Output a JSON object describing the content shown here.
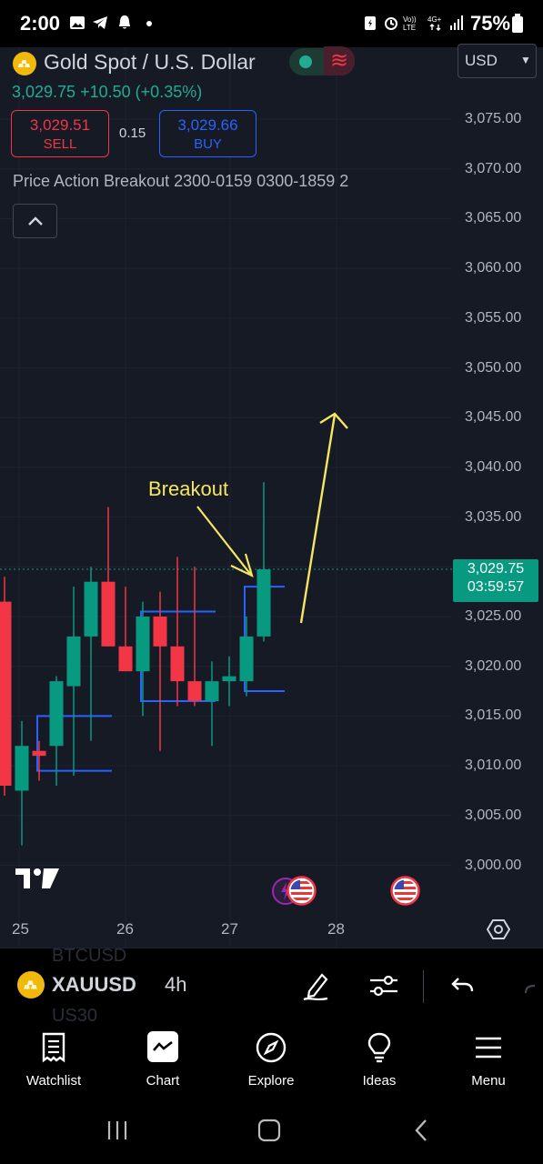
{
  "status_bar": {
    "time": "2:00",
    "battery": "75%"
  },
  "header": {
    "symbol_name": "Gold Spot / U.S. Dollar",
    "currency": "USD",
    "last_price": "3,029.75",
    "change": "+10.50",
    "change_percent": "(+0.35%)",
    "sell_price": "3,029.51",
    "sell_label": "SELL",
    "spread": "0.15",
    "buy_price": "3,029.66",
    "buy_label": "BUY",
    "indicator": "Price Action Breakout 2300-0159 0300-1859 2"
  },
  "price_scale": {
    "labels": [
      "3,075.00",
      "3,070.00",
      "3,065.00",
      "3,060.00",
      "3,055.00",
      "3,050.00",
      "3,045.00",
      "3,040.00",
      "3,035.00",
      "3,025.00",
      "3,020.00",
      "3,015.00",
      "3,010.00",
      "3,005.00",
      "3,000.00"
    ],
    "values": [
      3075,
      3070,
      3065,
      3060,
      3055,
      3050,
      3045,
      3040,
      3035,
      3025,
      3020,
      3015,
      3010,
      3005,
      3000
    ],
    "last_price_tag": "3,029.75",
    "countdown": "03:59:57"
  },
  "time_scale": {
    "labels": [
      "25",
      "26",
      "27",
      "28"
    ]
  },
  "annotation": {
    "text": "Breakout",
    "color": "#f5e663"
  },
  "chart_data": {
    "type": "candlestick",
    "symbol": "XAUUSD",
    "interval": "4h",
    "ylim": [
      2997.5,
      3079
    ],
    "up_color": "#089981",
    "down_color": "#f23645",
    "candles": [
      {
        "o": 3026.5,
        "h": 3029.0,
        "l": 3007.0,
        "c": 3008.0
      },
      {
        "o": 3007.5,
        "h": 3014.5,
        "l": 3002.0,
        "c": 3012.0
      },
      {
        "o": 3011.5,
        "h": 3012.5,
        "l": 3008.5,
        "c": 3011.0
      },
      {
        "o": 3012.0,
        "h": 3019.0,
        "l": 3008.0,
        "c": 3018.5
      },
      {
        "o": 3018.0,
        "h": 3028.0,
        "l": 3009.0,
        "c": 3023.0
      },
      {
        "o": 3023.0,
        "h": 3030.0,
        "l": 3012.5,
        "c": 3028.5
      },
      {
        "o": 3028.5,
        "h": 3036.0,
        "l": 3022.0,
        "c": 3022.0
      },
      {
        "o": 3022.0,
        "h": 3028.0,
        "l": 3020.5,
        "c": 3019.5
      },
      {
        "o": 3019.5,
        "h": 3026.5,
        "l": 3015.0,
        "c": 3025.0
      },
      {
        "o": 3025.0,
        "h": 3027.5,
        "l": 3011.5,
        "c": 3022.0
      },
      {
        "o": 3022.0,
        "h": 3031.0,
        "l": 3016.0,
        "c": 3018.5
      },
      {
        "o": 3018.5,
        "h": 3030.0,
        "l": 3016.0,
        "c": 3016.5
      },
      {
        "o": 3016.5,
        "h": 3020.5,
        "l": 3012.0,
        "c": 3018.5
      },
      {
        "o": 3018.5,
        "h": 3021.0,
        "l": 3016.0,
        "c": 3019.0
      },
      {
        "o": 3018.5,
        "h": 3025.0,
        "l": 3017.0,
        "c": 3023.0
      },
      {
        "o": 3023.0,
        "h": 3038.5,
        "l": 3022.5,
        "c": 3029.75
      }
    ],
    "breakout_boxes": [
      {
        "top": 3015.0,
        "bottom": 3009.5,
        "from": 2,
        "to": 6
      },
      {
        "top": 3025.5,
        "bottom": 3016.5,
        "from": 8,
        "to": 12
      },
      {
        "top": 3028.0,
        "bottom": 3017.5,
        "from": 14,
        "to": 16
      }
    ]
  },
  "toolbar": {
    "symbol": "XAUUSD",
    "interval": "4h",
    "ghost_top": "BTCUSD",
    "ghost_bottom": "US30"
  },
  "bottom_nav": {
    "items": [
      {
        "label": "Watchlist",
        "icon": "watchlist-icon"
      },
      {
        "label": "Chart",
        "icon": "chart-icon"
      },
      {
        "label": "Explore",
        "icon": "compass-icon"
      },
      {
        "label": "Ideas",
        "icon": "lightbulb-icon"
      },
      {
        "label": "Menu",
        "icon": "menu-icon"
      }
    ]
  }
}
